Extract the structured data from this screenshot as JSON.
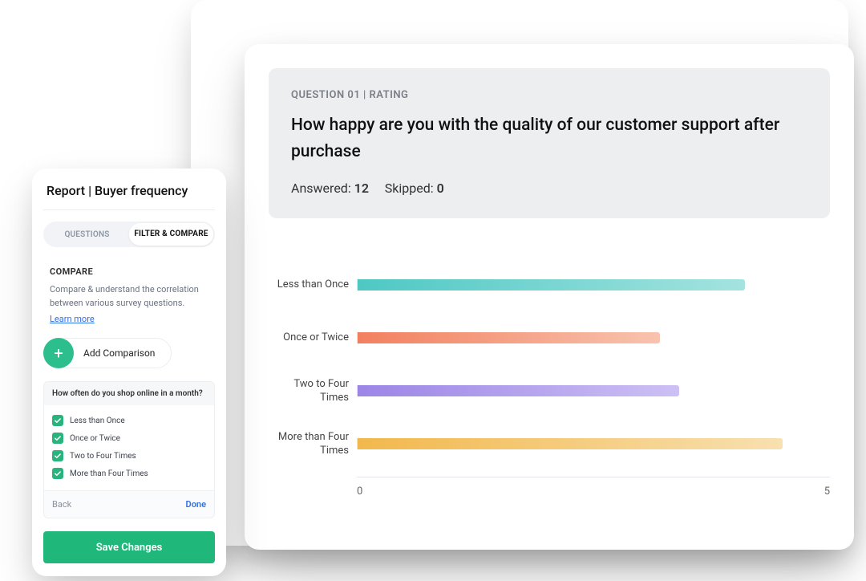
{
  "panel": {
    "title": "Report | Buyer frequency",
    "tabs": {
      "questions": "QUESTIONS",
      "filter": "FILTER & COMPARE"
    },
    "compare": {
      "heading": "COMPARE",
      "text": "Compare & understand the correlation between various survey questions.",
      "learn_more": "Learn more"
    },
    "add_comparison": "Add Comparison",
    "question": {
      "text": "How often do you shop online in a month?",
      "options": [
        "Less than Once",
        "Once or Twice",
        "Two to Four Times",
        "More than Four Times"
      ]
    },
    "back": "Back",
    "done": "Done",
    "save": "Save Changes"
  },
  "question_card": {
    "meta": "QUESTION 01 | RATING",
    "title": "How happy are you with the quality of our customer support after purchase",
    "answered_label": "Answered:",
    "answered_value": "12",
    "skipped_label": "Skipped:",
    "skipped_value": "0"
  },
  "chart_data": {
    "type": "bar",
    "orientation": "horizontal",
    "xlim": [
      0,
      5
    ],
    "xticks": [
      "0",
      "5"
    ],
    "categories": [
      "Less than Once",
      "Once or Twice",
      "Two to Four Times",
      "More than Four Times"
    ],
    "values": [
      4.1,
      3.2,
      3.4,
      4.5
    ],
    "colors": [
      "#4ec8c4",
      "#f2805f",
      "#9c85e6",
      "#f2b84c"
    ],
    "title": "",
    "xlabel": "",
    "ylabel": ""
  }
}
